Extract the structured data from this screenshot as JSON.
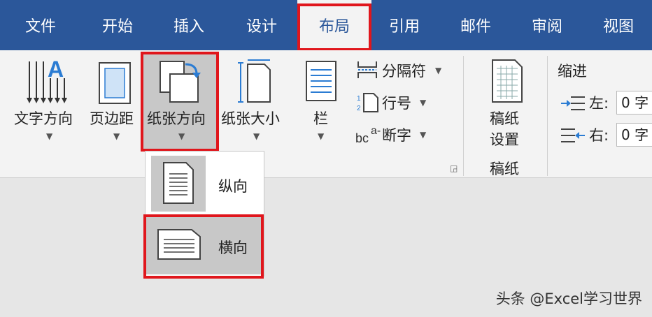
{
  "tabs": [
    "文件",
    "开始",
    "插入",
    "设计",
    "布局",
    "引用",
    "邮件",
    "审阅",
    "视图"
  ],
  "active_tab": "布局",
  "ribbon": {
    "text_direction": "文字方向",
    "margins": "页边距",
    "orientation": "纸张方向",
    "size": "纸张大小",
    "columns": "栏",
    "breaks": "分隔符",
    "line_numbers": "行号",
    "hyphenation": "断字",
    "draft_setup_line1": "稿纸",
    "draft_setup_line2": "设置",
    "draft_group_label": "稿纸",
    "indent_group_label": "缩进",
    "indent_left_label": "左:",
    "indent_left_value": "0 字",
    "indent_right_label": "右:",
    "indent_right_value": "0 字"
  },
  "dropdown": {
    "portrait": "纵向",
    "landscape": "横向"
  },
  "watermark": "头条 @Excel学习世界",
  "colors": {
    "titlebar": "#2b579a",
    "highlight": "#e0161c",
    "selected": "#c8c8c8"
  }
}
